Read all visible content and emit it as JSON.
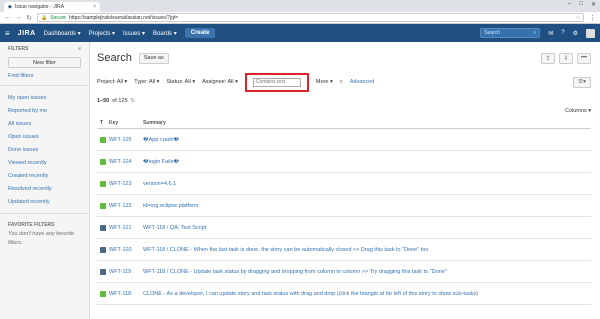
{
  "browser": {
    "tab_title": "Issue navigator - JIRA",
    "secure_label": "Secure",
    "url": "https://samplejiratolearnatlassian.net/issues/?jql="
  },
  "topnav": {
    "logo": "JIRA",
    "items": [
      "Dashboards ▾",
      "Projects ▾",
      "Issues ▾",
      "Boards ▾"
    ],
    "create": "Create",
    "search_placeholder": "Search"
  },
  "sidebar": {
    "filters_heading": "FILTERS",
    "new_filter": "New filter",
    "find_filters": "Find filters",
    "links": [
      "My open issues",
      "Reported by me",
      "All issues",
      "Open issues",
      "Done issues",
      "Viewed recently",
      "Created recently",
      "Resolved recently",
      "Updated recently"
    ],
    "favorite_heading": "FAVORITE FILTERS",
    "favorite_text": "You don't have any favorite filters."
  },
  "main": {
    "title": "Search",
    "save_as": "Save as",
    "criteria": [
      "Project: All ▾",
      "Type: All ▾",
      "Status: All ▾",
      "Assignee: All ▾"
    ],
    "contains_placeholder": "Contains text",
    "more": "More ▾",
    "advanced": "Advanced",
    "count_range": "1–50",
    "count_of": "of 125",
    "columns": "Columns ▾",
    "table_headers": {
      "t": "T",
      "key": "Key",
      "summary": "Summary"
    },
    "rows": [
      {
        "type": "story",
        "key": "WFT-125",
        "summary": "�App crash�"
      },
      {
        "type": "story",
        "key": "WFT-124",
        "summary": "�login Fails�"
      },
      {
        "type": "story",
        "key": "WFT-123",
        "summary": "version=4.6.1"
      },
      {
        "type": "story",
        "key": "WFT-122",
        "summary": "id=org.eclipse.platform"
      },
      {
        "type": "task",
        "key": "WFT-121",
        "summary": "WFT-118 / QA: Test Script"
      },
      {
        "type": "task",
        "key": "WFT-120",
        "summary": "WFT-118 / CLONE - When the last task is done, the story can be automatically closed >> Drag this task to \"Done\" too"
      },
      {
        "type": "task",
        "key": "WFT-119",
        "summary": "WFT-118 / CLONE - Update task status by dragging and dropping from column to column >> Try dragging this task to \"Done\""
      },
      {
        "type": "story",
        "key": "WFT-118",
        "summary": "CLONE - As a developer, I can update story and task status with drag and drop (click the triangle at far left of this story to show sub-tasks)"
      }
    ]
  }
}
